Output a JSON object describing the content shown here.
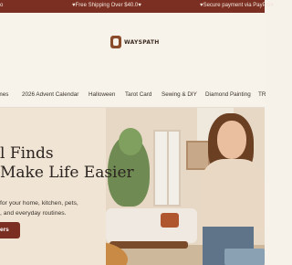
{
  "topbar": {
    "left_text": "o",
    "center_text": "♥Free Shipping Over $40.0♥",
    "right_text": "♥Secure payment via PayPal♥"
  },
  "brand": {
    "logo_text": "WAYSPATH"
  },
  "nav": {
    "items": [
      {
        "label": "ames"
      },
      {
        "label": "2026 Advent Calendar"
      },
      {
        "label": "Halloween"
      },
      {
        "label": "Tarot Card"
      },
      {
        "label": "Sewing & DIY"
      },
      {
        "label": "Diamond Painting"
      },
      {
        "label": "TR"
      }
    ]
  },
  "hero": {
    "headline_line1": "l Finds",
    "headline_line2": "Make Life Easier",
    "subtext_line1": "for your home, kitchen, pets,",
    "subtext_line2": ", and everyday routines.",
    "cta_label": "ers"
  },
  "colors": {
    "topbar_bg": "#7a2f22",
    "page_bg": "#f6f1e9",
    "accent": "#7a2f22"
  }
}
